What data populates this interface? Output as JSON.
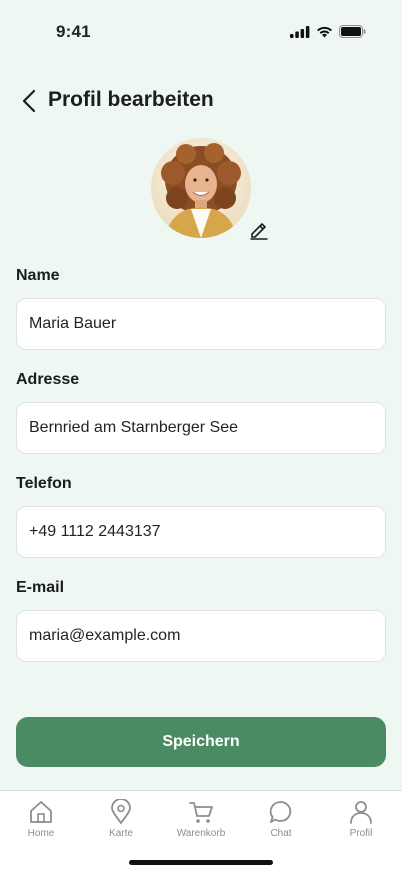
{
  "status": {
    "time": "9:41"
  },
  "header": {
    "title": "Profil bearbeiten"
  },
  "form": {
    "name": {
      "label": "Name",
      "value": "Maria Bauer"
    },
    "address": {
      "label": "Adresse",
      "value": "Bernried am Starnberger See"
    },
    "phone": {
      "label": "Telefon",
      "value": "+49 1112 2443137"
    },
    "email": {
      "label": "E-mail",
      "value": "maria@example.com"
    }
  },
  "actions": {
    "save_label": "Speichern"
  },
  "tabbar": {
    "items": [
      {
        "label": "Home",
        "icon": "home-icon"
      },
      {
        "label": "Karte",
        "icon": "map-pin-icon"
      },
      {
        "label": "Warenkorb",
        "icon": "cart-icon"
      },
      {
        "label": "Chat",
        "icon": "chat-icon"
      },
      {
        "label": "Profil",
        "icon": "user-icon"
      }
    ]
  },
  "colors": {
    "background": "#eef7f1",
    "accent": "#4b8b63",
    "text": "#1f2421",
    "muted": "#8a8f8c"
  }
}
